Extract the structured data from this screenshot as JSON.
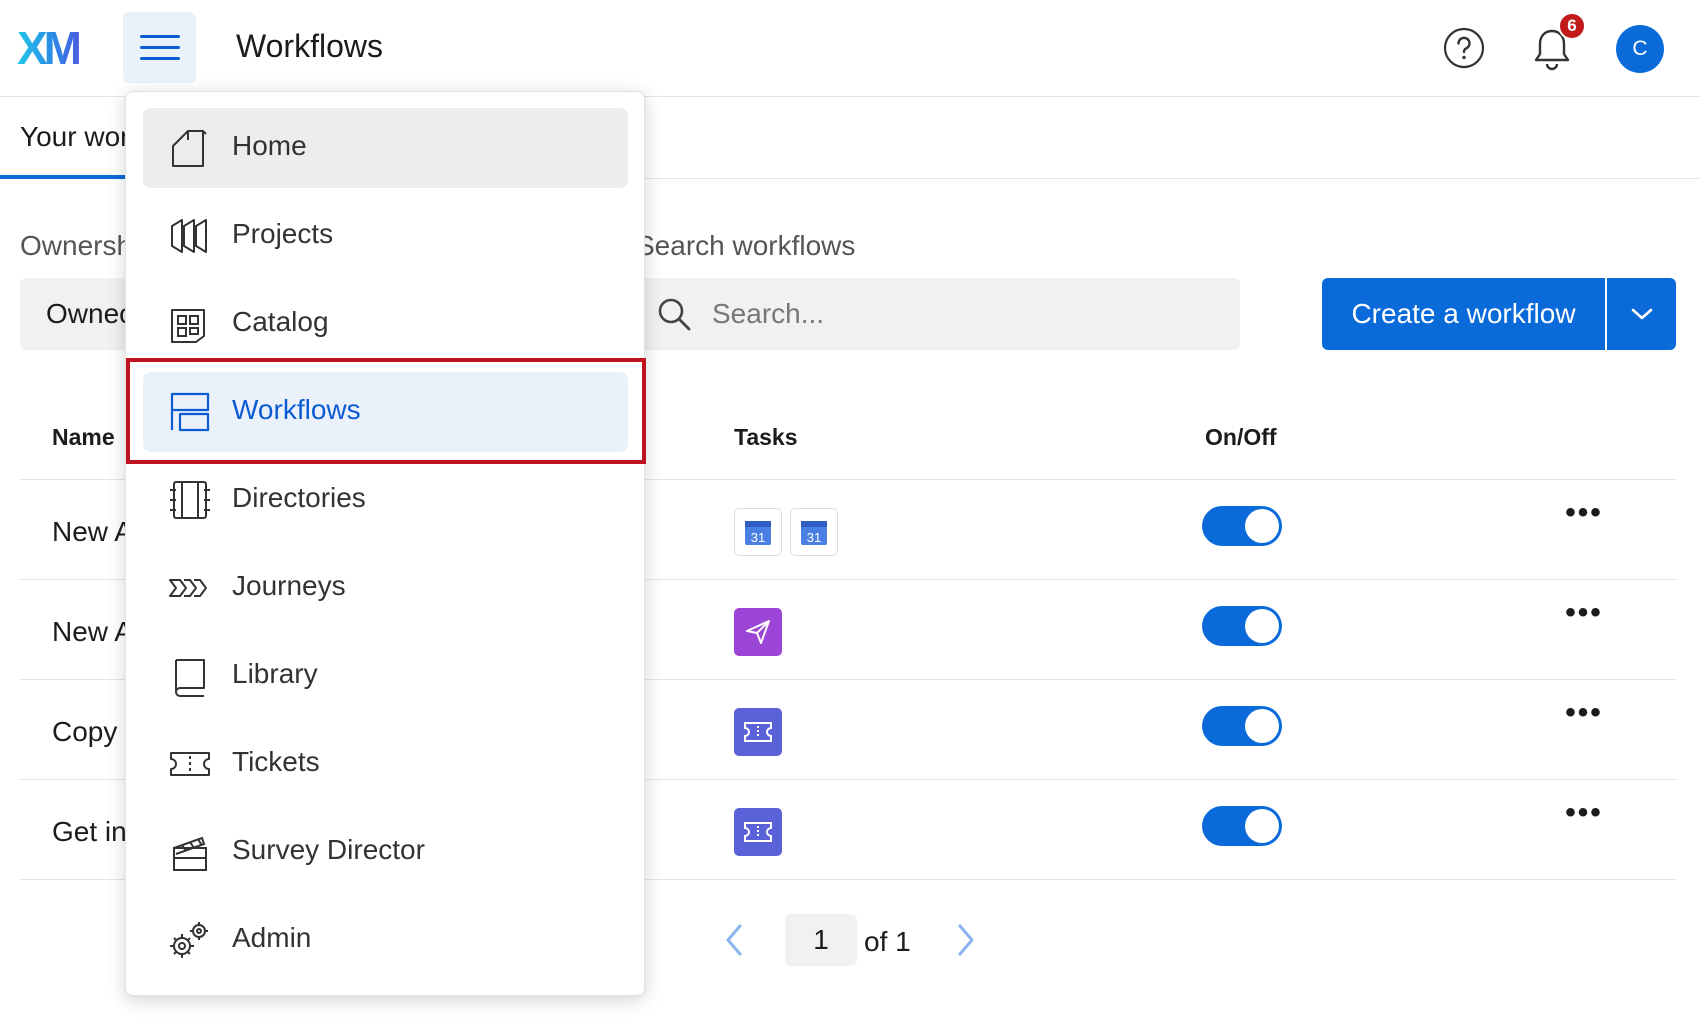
{
  "header": {
    "logo_text": "XM",
    "title": "Workflows",
    "notification_count": "6",
    "avatar_initial": "C"
  },
  "tabs": {
    "active_label_partial": "Your wor"
  },
  "filters": {
    "ownership_label_partial": "Ownersh",
    "ownership_value_partial": "Ownec",
    "search_label": "Search workflows",
    "search_placeholder": "Search...",
    "create_button": "Create a workflow"
  },
  "table": {
    "columns": {
      "name": "Name",
      "tasks": "Tasks",
      "onoff": "On/Off"
    },
    "rows": [
      {
        "name_partial": "New A",
        "tasks": [
          "calendar-icon",
          "calendar-icon"
        ],
        "enabled": true
      },
      {
        "name_partial": "New A",
        "tasks": [
          "email-icon"
        ],
        "enabled": true
      },
      {
        "name_partial": "Copy",
        "tasks": [
          "ticket-icon"
        ],
        "enabled": true
      },
      {
        "name_partial": "Get in",
        "tasks": [
          "ticket-icon"
        ],
        "enabled": true
      }
    ],
    "calendar_day": "31"
  },
  "pagination": {
    "current_page": "1",
    "of_label": "of 1"
  },
  "nav_menu": {
    "items": [
      {
        "label": "Home",
        "icon": "home-icon",
        "state": "hover"
      },
      {
        "label": "Projects",
        "icon": "projects-icon",
        "state": "normal"
      },
      {
        "label": "Catalog",
        "icon": "catalog-icon",
        "state": "normal"
      },
      {
        "label": "Workflows",
        "icon": "workflows-icon",
        "state": "selected"
      },
      {
        "label": "Directories",
        "icon": "directories-icon",
        "state": "normal"
      },
      {
        "label": "Journeys",
        "icon": "journeys-icon",
        "state": "normal"
      },
      {
        "label": "Library",
        "icon": "library-icon",
        "state": "normal"
      },
      {
        "label": "Tickets",
        "icon": "tickets-icon",
        "state": "normal"
      },
      {
        "label": "Survey Director",
        "icon": "survey-director-icon",
        "state": "normal"
      },
      {
        "label": "Admin",
        "icon": "admin-icon",
        "state": "normal"
      }
    ]
  },
  "colors": {
    "brand_blue": "#0b6ad9",
    "highlight_red": "#c1121f",
    "email_purple": "#9b45d6",
    "ticket_indigo": "#5b62d9"
  }
}
